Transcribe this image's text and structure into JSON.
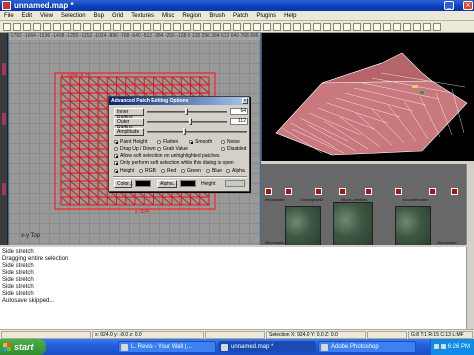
{
  "window": {
    "title": "unnamed.map *"
  },
  "menu": [
    "File",
    "Edit",
    "View",
    "Selection",
    "Bsp",
    "Grid",
    "Textures",
    "Misc",
    "Region",
    "Brush",
    "Patch",
    "Plugins",
    "Help"
  ],
  "grid_view": {
    "ruler": "-1792  -1664  -1536  -1408  -1280  -1152  -1024  -896  -768  -640  -512  -384  -256  -128  0  128  256  384  512  640  768  896  1024  1152",
    "patch_label": "x  -1664  -8.76",
    "patch_scale": "x: 924",
    "view_label": "x-y  Top"
  },
  "dialog": {
    "title": "Advanced Patch Editing Options",
    "inner_radius_label": "Inner Radius",
    "inner_radius_value": "64",
    "inner_radius_level": 0.5,
    "outer_radius_label": "Outer Radius",
    "outer_radius_value": "112",
    "outer_radius_level": 0.55,
    "amplitude_label": "Amplitude",
    "amplitude_level": 0.38,
    "modes": [
      {
        "label": "Paint Height",
        "on": true
      },
      {
        "label": "Flatten",
        "on": false
      },
      {
        "label": "Smooth",
        "on": true
      },
      {
        "label": "Noise",
        "on": false
      }
    ],
    "modes2": [
      {
        "label": "Drag Up / Down",
        "on": false
      },
      {
        "label": "Grab Value",
        "on": false
      },
      {
        "label": "Disabled",
        "on": false
      }
    ],
    "check_soft": "Allow soft selection on unhighlighted patches",
    "check_only": "Only perform soft selection while this dialog is open",
    "channels": [
      "Height",
      "RGB",
      "Red",
      "Green",
      "Blue",
      "Alpha"
    ],
    "color_button": "Color...",
    "alpha_button": "Alpha...",
    "height_label": "Height"
  },
  "textures": {
    "names": [
      "t/floorwater",
      "t/orangeset2",
      "t/floor_pebbles",
      "t/counterwater",
      "t/floorwater",
      "t/floorwater"
    ]
  },
  "console": {
    "lines": [
      "Side stretch",
      "Dragging entire selection",
      "Side stretch",
      "Side stretch",
      "Side stretch",
      "Side stretch",
      "Side stretch",
      "Autosave skipped..."
    ]
  },
  "status": {
    "help": "",
    "coords": "x:  924.0  y:  -8.0  z:  0.0",
    "selection": "Selection  X: 924.0  Y: 0.0  Z: 0.0",
    "grid": "G:8 T:1 R:15 C:13 L:MF"
  },
  "taskbar": {
    "start": "start",
    "tasks": [
      "L. Revis - Your Wall (...",
      "unnamed.map *",
      "Adobe Photoshop"
    ],
    "clock": "6:26 PM"
  }
}
